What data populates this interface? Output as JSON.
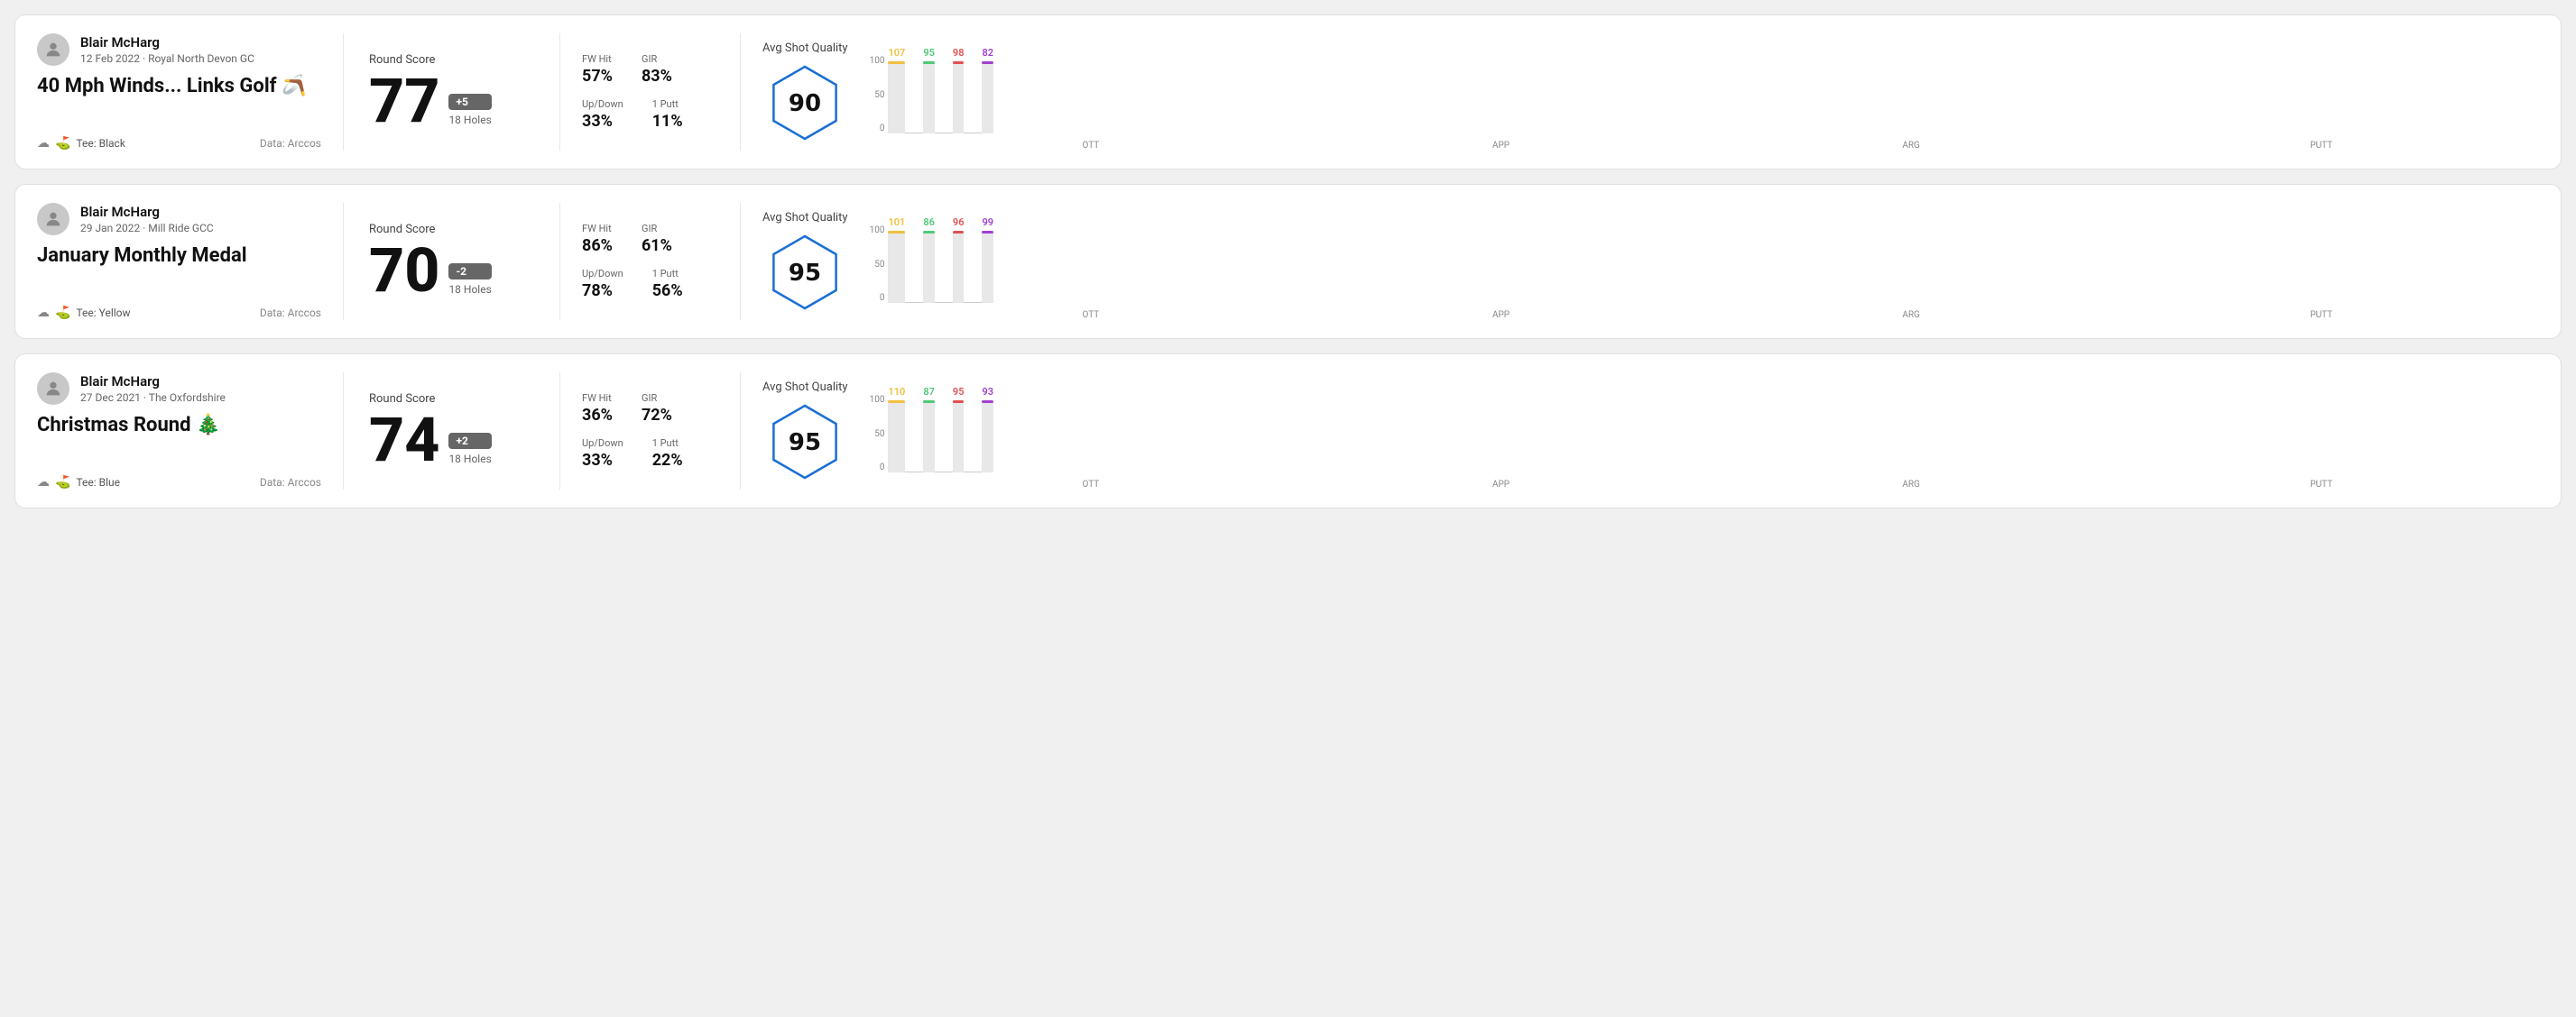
{
  "rounds": [
    {
      "id": "round-1",
      "player": "Blair McHarg",
      "date_course": "12 Feb 2022 · Royal North Devon GC",
      "title": "40 Mph Winds... Links Golf 🪃",
      "tee": "Black",
      "data_source": "Data: Arccos",
      "round_score_label": "Round Score",
      "score": "77",
      "score_diff": "+5",
      "holes": "18 Holes",
      "fw_hit_label": "FW Hit",
      "fw_hit": "57%",
      "gir_label": "GIR",
      "gir": "83%",
      "updown_label": "Up/Down",
      "updown": "33%",
      "oneputt_label": "1 Putt",
      "oneputt": "11%",
      "quality_label": "Avg Shot Quality",
      "quality_score": "90",
      "chart": {
        "bars": [
          {
            "label": "OTT",
            "value": 107,
            "color": "#f0c040",
            "max": 130
          },
          {
            "label": "APP",
            "value": 95,
            "color": "#50c878",
            "max": 130
          },
          {
            "label": "ARG",
            "value": 98,
            "color": "#e05050",
            "max": 130
          },
          {
            "label": "PUTT",
            "value": 82,
            "color": "#a040d0",
            "max": 130
          }
        ]
      }
    },
    {
      "id": "round-2",
      "player": "Blair McHarg",
      "date_course": "29 Jan 2022 · Mill Ride GCC",
      "title": "January Monthly Medal",
      "tee": "Yellow",
      "data_source": "Data: Arccos",
      "round_score_label": "Round Score",
      "score": "70",
      "score_diff": "-2",
      "holes": "18 Holes",
      "fw_hit_label": "FW Hit",
      "fw_hit": "86%",
      "gir_label": "GIR",
      "gir": "61%",
      "updown_label": "Up/Down",
      "updown": "78%",
      "oneputt_label": "1 Putt",
      "oneputt": "56%",
      "quality_label": "Avg Shot Quality",
      "quality_score": "95",
      "chart": {
        "bars": [
          {
            "label": "OTT",
            "value": 101,
            "color": "#f0c040",
            "max": 130
          },
          {
            "label": "APP",
            "value": 86,
            "color": "#50c878",
            "max": 130
          },
          {
            "label": "ARG",
            "value": 96,
            "color": "#e05050",
            "max": 130
          },
          {
            "label": "PUTT",
            "value": 99,
            "color": "#a040d0",
            "max": 130
          }
        ]
      }
    },
    {
      "id": "round-3",
      "player": "Blair McHarg",
      "date_course": "27 Dec 2021 · The Oxfordshire",
      "title": "Christmas Round 🎄",
      "tee": "Blue",
      "data_source": "Data: Arccos",
      "round_score_label": "Round Score",
      "score": "74",
      "score_diff": "+2",
      "holes": "18 Holes",
      "fw_hit_label": "FW Hit",
      "fw_hit": "36%",
      "gir_label": "GIR",
      "gir": "72%",
      "updown_label": "Up/Down",
      "updown": "33%",
      "oneputt_label": "1 Putt",
      "oneputt": "22%",
      "quality_label": "Avg Shot Quality",
      "quality_score": "95",
      "chart": {
        "bars": [
          {
            "label": "OTT",
            "value": 110,
            "color": "#f0c040",
            "max": 130
          },
          {
            "label": "APP",
            "value": 87,
            "color": "#50c878",
            "max": 130
          },
          {
            "label": "ARG",
            "value": 95,
            "color": "#e05050",
            "max": 130
          },
          {
            "label": "PUTT",
            "value": 93,
            "color": "#a040d0",
            "max": 130
          }
        ]
      }
    }
  ]
}
